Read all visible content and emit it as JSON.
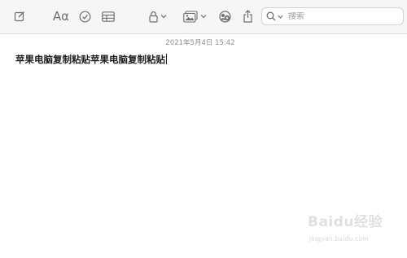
{
  "toolbar": {
    "format_label": "Aα",
    "search_placeholder": "搜索"
  },
  "note": {
    "timestamp": "2021年5月4日 15:42",
    "body": "苹果电脑复制粘贴苹果电脑复制粘贴"
  },
  "watermark": {
    "logo_text": "Baidu经验",
    "url": "jingyan.baidu.com"
  },
  "icons": {
    "compose": "compose-icon",
    "checklist": "checklist-icon",
    "table": "table-icon",
    "lock": "lock-icon",
    "media": "media-icon",
    "collaborate": "collaborate-icon",
    "share": "share-icon",
    "search": "search-icon"
  },
  "colors": {
    "toolbar_bg": "#f6f6f6",
    "icon": "#6e6e73",
    "timestamp": "#8e8e93",
    "text": "#1d1d1f"
  }
}
